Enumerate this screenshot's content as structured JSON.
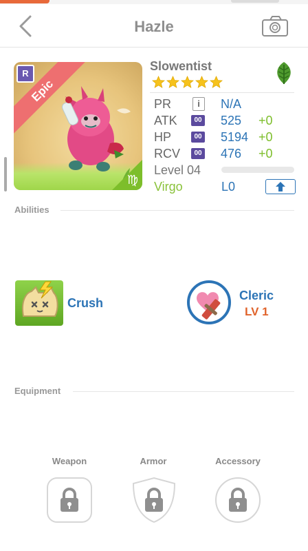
{
  "header": {
    "title": "Hazle"
  },
  "monster": {
    "rarity_badge": "R",
    "rarity": "Epic",
    "name": "Slowentist",
    "star_count": 5,
    "element_icon": "leaf-icon",
    "zodiac_symbol": "♍"
  },
  "stats": {
    "pr": {
      "label": "PR",
      "value": "N/A",
      "icon": "i"
    },
    "atk": {
      "label": "ATK",
      "icon_text": "00",
      "value": "525",
      "bonus": "+0"
    },
    "hp": {
      "label": "HP",
      "icon_text": "00",
      "value": "5194",
      "bonus": "+0"
    },
    "rcv": {
      "label": "RCV",
      "icon_text": "00",
      "value": "476",
      "bonus": "+0"
    },
    "level_label": "Level 04",
    "level_progress": 0,
    "sign": "Virgo",
    "limit": "L0"
  },
  "abilities": {
    "section_title": "Abilities",
    "ability": {
      "name": "Crush"
    },
    "class": {
      "name": "Cleric",
      "level": "LV 1"
    }
  },
  "equipment": {
    "section_title": "Equipment",
    "slots": [
      {
        "label": "Weapon"
      },
      {
        "label": "Armor"
      },
      {
        "label": "Accessory"
      }
    ]
  },
  "colors": {
    "accent_blue": "#2c74b6",
    "bonus_green": "#7dbe2b",
    "epic_red": "#ee6f70",
    "level_orange": "#e0632b"
  }
}
